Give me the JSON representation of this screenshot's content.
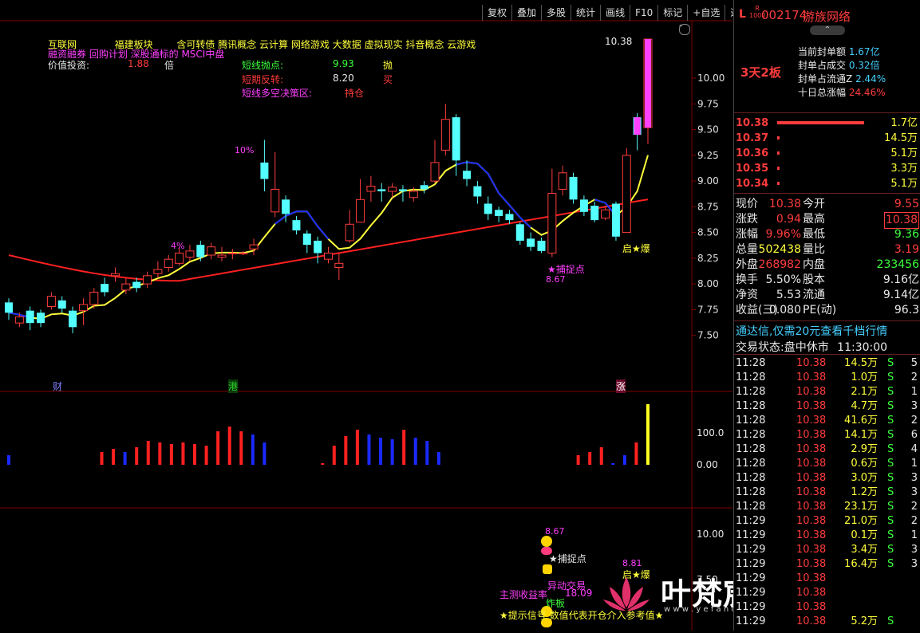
{
  "toolbar": [
    "复权",
    "叠加",
    "多股",
    "统计",
    "画线",
    "F10",
    "标记",
    "+自选",
    "返回"
  ],
  "stock": {
    "code": "002174",
    "name": "游族网络",
    "prefix": "L",
    "badge_top": "R",
    "badge_bottom": "1000",
    "streak": "3天2板"
  },
  "header_info": {
    "line1": [
      "互联网",
      "福建板块",
      "含可转债",
      "腾讯概念",
      "云计算",
      "网络游戏",
      "大数据",
      "虚拟现实",
      "抖音概念",
      "云游戏"
    ],
    "line2": "融资融券 回购计划 深股通标的 MSCI中盘",
    "valuation_label": "价值投资:",
    "valuation_value": "1.88",
    "valuation_unit": "倍",
    "short_label": "短线抛点:",
    "short_value": "9.93",
    "short_action": "抛",
    "reversal_label": "短期反转:",
    "reversal_value": "8.20",
    "reversal_action": "买",
    "decision_label": "短线多空决策区:",
    "decision_value": "持仓"
  },
  "price_axis": [
    "10.00",
    "9.75",
    "9.50",
    "9.25",
    "9.00",
    "8.75",
    "8.50",
    "8.25",
    "8.00",
    "7.75",
    "7.50"
  ],
  "high_label": "10.38",
  "chart_annotations": {
    "pct10": "10%",
    "pct4": "4%",
    "capture": "★捕捉点",
    "capture_price": "8.67",
    "launch": "启★爆",
    "cai": "财",
    "gang": "港",
    "zhang": "涨"
  },
  "volume_axis": [
    "100.0",
    "0.00"
  ],
  "sub_axis": [
    "10.00",
    "7.50"
  ],
  "sub_annotations": {
    "price_top": "8.67",
    "capture": "★捕捉点",
    "launch_price": "8.81",
    "launch": "启★爆",
    "abnormal": "异动交易",
    "main_profit": "主测收益率",
    "main_profit_value": "18.09",
    "blast": "炸板",
    "hint": "★提示信号 数值代表开仓介入参考值★"
  },
  "watermark": {
    "title": "叶梵宸指标公式网",
    "url": "w w w . y e f a n c h e n . c o m"
  },
  "seal": {
    "rows": [
      {
        "label": "当前封单额",
        "value": "1.67亿"
      },
      {
        "label": "封单占成交",
        "value": "0.32倍"
      },
      {
        "label": "封单占流通Z",
        "value": "2.44%"
      },
      {
        "label": "十日总涨幅",
        "value": "24.46%"
      }
    ]
  },
  "order_book": [
    {
      "price": "10.38",
      "vol": "1.7亿",
      "bar": 0.7
    },
    {
      "price": "10.37",
      "vol": "14.5万",
      "bar": 0.01
    },
    {
      "price": "10.36",
      "vol": "5.1万",
      "bar": 0.01
    },
    {
      "price": "10.35",
      "vol": "3.3万",
      "bar": 0.01
    },
    {
      "price": "10.34",
      "vol": "5.1万",
      "bar": 0.01
    }
  ],
  "quote": [
    {
      "l1": "现价",
      "v1": "10.38",
      "c1": "red",
      "l2": "今开",
      "v2": "9.55",
      "c2": "red"
    },
    {
      "l1": "涨跌",
      "v1": "0.94",
      "c1": "red",
      "l2": "最高",
      "v2": "10.38",
      "c2": "red"
    },
    {
      "l1": "涨幅",
      "v1": "9.96%",
      "c1": "red",
      "l2": "最低",
      "v2": "9.36",
      "c2": "green"
    },
    {
      "l1": "总量",
      "v1": "502438",
      "c1": "yellow",
      "l2": "量比",
      "v2": "3.19",
      "c2": "red"
    },
    {
      "l1": "外盘",
      "v1": "268982",
      "c1": "red",
      "l2": "内盘",
      "v2": "233456",
      "c2": "green"
    },
    {
      "l1": "换手",
      "v1": "5.50%",
      "c1": "white",
      "l2": "股本",
      "v2": "9.16亿",
      "c2": "white"
    },
    {
      "l1": "净资",
      "v1": "5.53",
      "c1": "white",
      "l2": "流通",
      "v2": "9.14亿",
      "c2": "white"
    },
    {
      "l1": "收益(三)",
      "v1": "0.080",
      "c1": "white",
      "l2": "PE(动)",
      "v2": "96.3",
      "c2": "white"
    }
  ],
  "promo": "通达信,仅需20元查看千档行情",
  "trade_status": {
    "label": "交易状态:",
    "value": "盘中休市",
    "time": "11:30:00"
  },
  "trades": [
    {
      "t": "11:28",
      "p": "10.38",
      "v": "14.5万",
      "d": "S",
      "n": "5"
    },
    {
      "t": "11:28",
      "p": "10.38",
      "v": "1.0万",
      "d": "S",
      "n": "2"
    },
    {
      "t": "11:28",
      "p": "10.38",
      "v": "2.1万",
      "d": "S",
      "n": "1"
    },
    {
      "t": "11:28",
      "p": "10.38",
      "v": "4.7万",
      "d": "S",
      "n": "3"
    },
    {
      "t": "11:28",
      "p": "10.38",
      "v": "41.6万",
      "d": "S",
      "n": "2"
    },
    {
      "t": "11:28",
      "p": "10.38",
      "v": "14.1万",
      "d": "S",
      "n": "6"
    },
    {
      "t": "11:28",
      "p": "10.38",
      "v": "2.9万",
      "d": "S",
      "n": "4"
    },
    {
      "t": "11:28",
      "p": "10.38",
      "v": "0.6万",
      "d": "S",
      "n": "1"
    },
    {
      "t": "11:28",
      "p": "10.38",
      "v": "3.0万",
      "d": "S",
      "n": "3"
    },
    {
      "t": "11:28",
      "p": "10.38",
      "v": "1.2万",
      "d": "S",
      "n": "3"
    },
    {
      "t": "11:28",
      "p": "10.38",
      "v": "23.1万",
      "d": "S",
      "n": "2"
    },
    {
      "t": "11:29",
      "p": "10.38",
      "v": "21.0万",
      "d": "S",
      "n": "2"
    },
    {
      "t": "11:29",
      "p": "10.38",
      "v": "0.1万",
      "d": "S",
      "n": "1"
    },
    {
      "t": "11:29",
      "p": "10.38",
      "v": "3.4万",
      "d": "S",
      "n": "3"
    },
    {
      "t": "11:29",
      "p": "10.38",
      "v": "16.4万",
      "d": "S",
      "n": "3"
    },
    {
      "t": "11:29",
      "p": "10.38",
      "v": "",
      "d": "",
      "n": ""
    },
    {
      "t": "11:29",
      "p": "10.38",
      "v": "",
      "d": "",
      "n": ""
    },
    {
      "t": "11:29",
      "p": "10.38",
      "v": "",
      "d": "",
      "n": ""
    },
    {
      "t": "11:29",
      "p": "10.38",
      "v": "5.2万",
      "d": "S",
      "n": ""
    }
  ],
  "chart_data": {
    "type": "candlestick",
    "ylim": [
      7.35,
      10.45
    ],
    "candles": [
      [
        7.82,
        7.72,
        7.86,
        7.65
      ],
      [
        7.62,
        7.68,
        7.72,
        7.58
      ],
      [
        7.74,
        7.62,
        7.78,
        7.55
      ],
      [
        7.72,
        7.62,
        7.75,
        7.58
      ],
      [
        7.78,
        7.88,
        7.92,
        7.75
      ],
      [
        7.84,
        7.76,
        7.88,
        7.72
      ],
      [
        7.74,
        7.58,
        7.78,
        7.52
      ],
      [
        7.74,
        7.8,
        7.86,
        7.6
      ],
      [
        7.8,
        7.92,
        7.96,
        7.76
      ],
      [
        8.0,
        7.92,
        8.06,
        7.88
      ],
      [
        8.08,
        8.1,
        8.16,
        8.02
      ],
      [
        7.94,
        8.0,
        8.06,
        7.9
      ],
      [
        8.02,
        7.96,
        8.06,
        7.92
      ],
      [
        8.0,
        8.08,
        8.12,
        7.96
      ],
      [
        8.1,
        8.14,
        8.22,
        8.06
      ],
      [
        8.16,
        8.24,
        8.28,
        8.12
      ],
      [
        8.2,
        8.3,
        8.36,
        8.18
      ],
      [
        8.26,
        8.32,
        8.38,
        8.22
      ],
      [
        8.38,
        8.26,
        8.42,
        8.22
      ],
      [
        8.28,
        8.36,
        8.4,
        8.24
      ],
      [
        8.26,
        8.28,
        8.36,
        8.22
      ],
      [
        8.3,
        8.3,
        8.34,
        8.24
      ],
      [
        8.3,
        8.3,
        8.32,
        8.28
      ],
      [
        8.34,
        8.38,
        8.44,
        8.28
      ],
      [
        9.18,
        9.02,
        9.4,
        8.9
      ],
      [
        8.7,
        8.92,
        9.28,
        8.65
      ],
      [
        8.82,
        8.68,
        8.86,
        8.6
      ],
      [
        8.62,
        8.52,
        8.66,
        8.48
      ],
      [
        8.49,
        8.38,
        8.52,
        8.3
      ],
      [
        8.42,
        8.3,
        8.46,
        8.2
      ],
      [
        8.24,
        8.3,
        8.36,
        8.2
      ],
      [
        8.16,
        8.2,
        8.3,
        8.04
      ],
      [
        8.42,
        8.58,
        8.72,
        8.4
      ],
      [
        8.6,
        8.82,
        9.02,
        8.6
      ],
      [
        8.9,
        8.95,
        9.05,
        8.8
      ],
      [
        8.92,
        8.9,
        8.98,
        8.8
      ],
      [
        8.9,
        8.94,
        8.98,
        8.84
      ],
      [
        8.92,
        8.9,
        8.96,
        8.8
      ],
      [
        8.84,
        8.9,
        8.94,
        8.8
      ],
      [
        8.96,
        8.92,
        9.0,
        8.88
      ],
      [
        9.0,
        9.18,
        9.4,
        8.98
      ],
      [
        9.3,
        9.6,
        9.75,
        9.25
      ],
      [
        9.62,
        9.2,
        9.65,
        9.05
      ],
      [
        9.1,
        9.02,
        9.2,
        8.95
      ],
      [
        8.95,
        8.85,
        9.0,
        8.78
      ],
      [
        8.78,
        8.68,
        8.85,
        8.62
      ],
      [
        8.72,
        8.66,
        8.75,
        8.6
      ],
      [
        8.68,
        8.62,
        8.72,
        8.58
      ],
      [
        8.58,
        8.42,
        8.6,
        8.38
      ],
      [
        8.44,
        8.36,
        8.5,
        8.32
      ],
      [
        8.42,
        8.32,
        8.45,
        8.3
      ],
      [
        8.3,
        8.88,
        9.12,
        8.26
      ],
      [
        8.92,
        9.08,
        9.15,
        8.86
      ],
      [
        9.04,
        8.82,
        9.08,
        8.78
      ],
      [
        8.82,
        8.7,
        8.86,
        8.66
      ],
      [
        8.76,
        8.62,
        8.8,
        8.6
      ],
      [
        8.64,
        8.72,
        8.76,
        8.62
      ],
      [
        8.78,
        8.46,
        8.8,
        8.42
      ],
      [
        8.5,
        9.25,
        9.32,
        8.5
      ],
      [
        9.62,
        9.45,
        9.66,
        9.3
      ],
      [
        9.52,
        10.38,
        10.38,
        9.36
      ]
    ],
    "volumes": [
      [
        0.3,
        "b"
      ],
      [
        0,
        "b"
      ],
      [
        0,
        "b"
      ],
      [
        0,
        "b"
      ],
      [
        0,
        "b"
      ],
      [
        0,
        "b"
      ],
      [
        0,
        "b"
      ],
      [
        0,
        "b"
      ],
      [
        0.4,
        "r"
      ],
      [
        0.5,
        "r"
      ],
      [
        0.4,
        "b"
      ],
      [
        0.55,
        "r"
      ],
      [
        0.75,
        "r"
      ],
      [
        0.7,
        "r"
      ],
      [
        0.65,
        "r"
      ],
      [
        0.7,
        "r"
      ],
      [
        0.65,
        "r"
      ],
      [
        0.6,
        "r"
      ],
      [
        1.05,
        "r"
      ],
      [
        1.2,
        "r"
      ],
      [
        1.05,
        "r"
      ],
      [
        0.95,
        "b"
      ],
      [
        0.7,
        "b"
      ],
      [
        0,
        "b"
      ],
      [
        0,
        "b"
      ],
      [
        0,
        "b"
      ],
      [
        0,
        "b"
      ],
      [
        0.05,
        "r"
      ],
      [
        0.6,
        "r"
      ],
      [
        0.9,
        "r"
      ],
      [
        1.1,
        "r"
      ],
      [
        0.95,
        "b"
      ],
      [
        0.85,
        "b"
      ],
      [
        0.8,
        "b"
      ],
      [
        1.1,
        "r"
      ],
      [
        0.85,
        "b"
      ],
      [
        0.75,
        "b"
      ],
      [
        0.4,
        "b"
      ],
      [
        0,
        "b"
      ],
      [
        0,
        "b"
      ],
      [
        0,
        "b"
      ],
      [
        0,
        "b"
      ],
      [
        0,
        "b"
      ],
      [
        0,
        "b"
      ],
      [
        0,
        "b"
      ],
      [
        0,
        "b"
      ],
      [
        0,
        "b"
      ],
      [
        0,
        "b"
      ],
      [
        0,
        "b"
      ],
      [
        0.3,
        "r"
      ],
      [
        0.4,
        "r"
      ],
      [
        0.55,
        "r"
      ],
      [
        0.05,
        "b"
      ],
      [
        0.3,
        "b"
      ],
      [
        0.7,
        "r"
      ],
      [
        1.9,
        "y"
      ]
    ]
  }
}
